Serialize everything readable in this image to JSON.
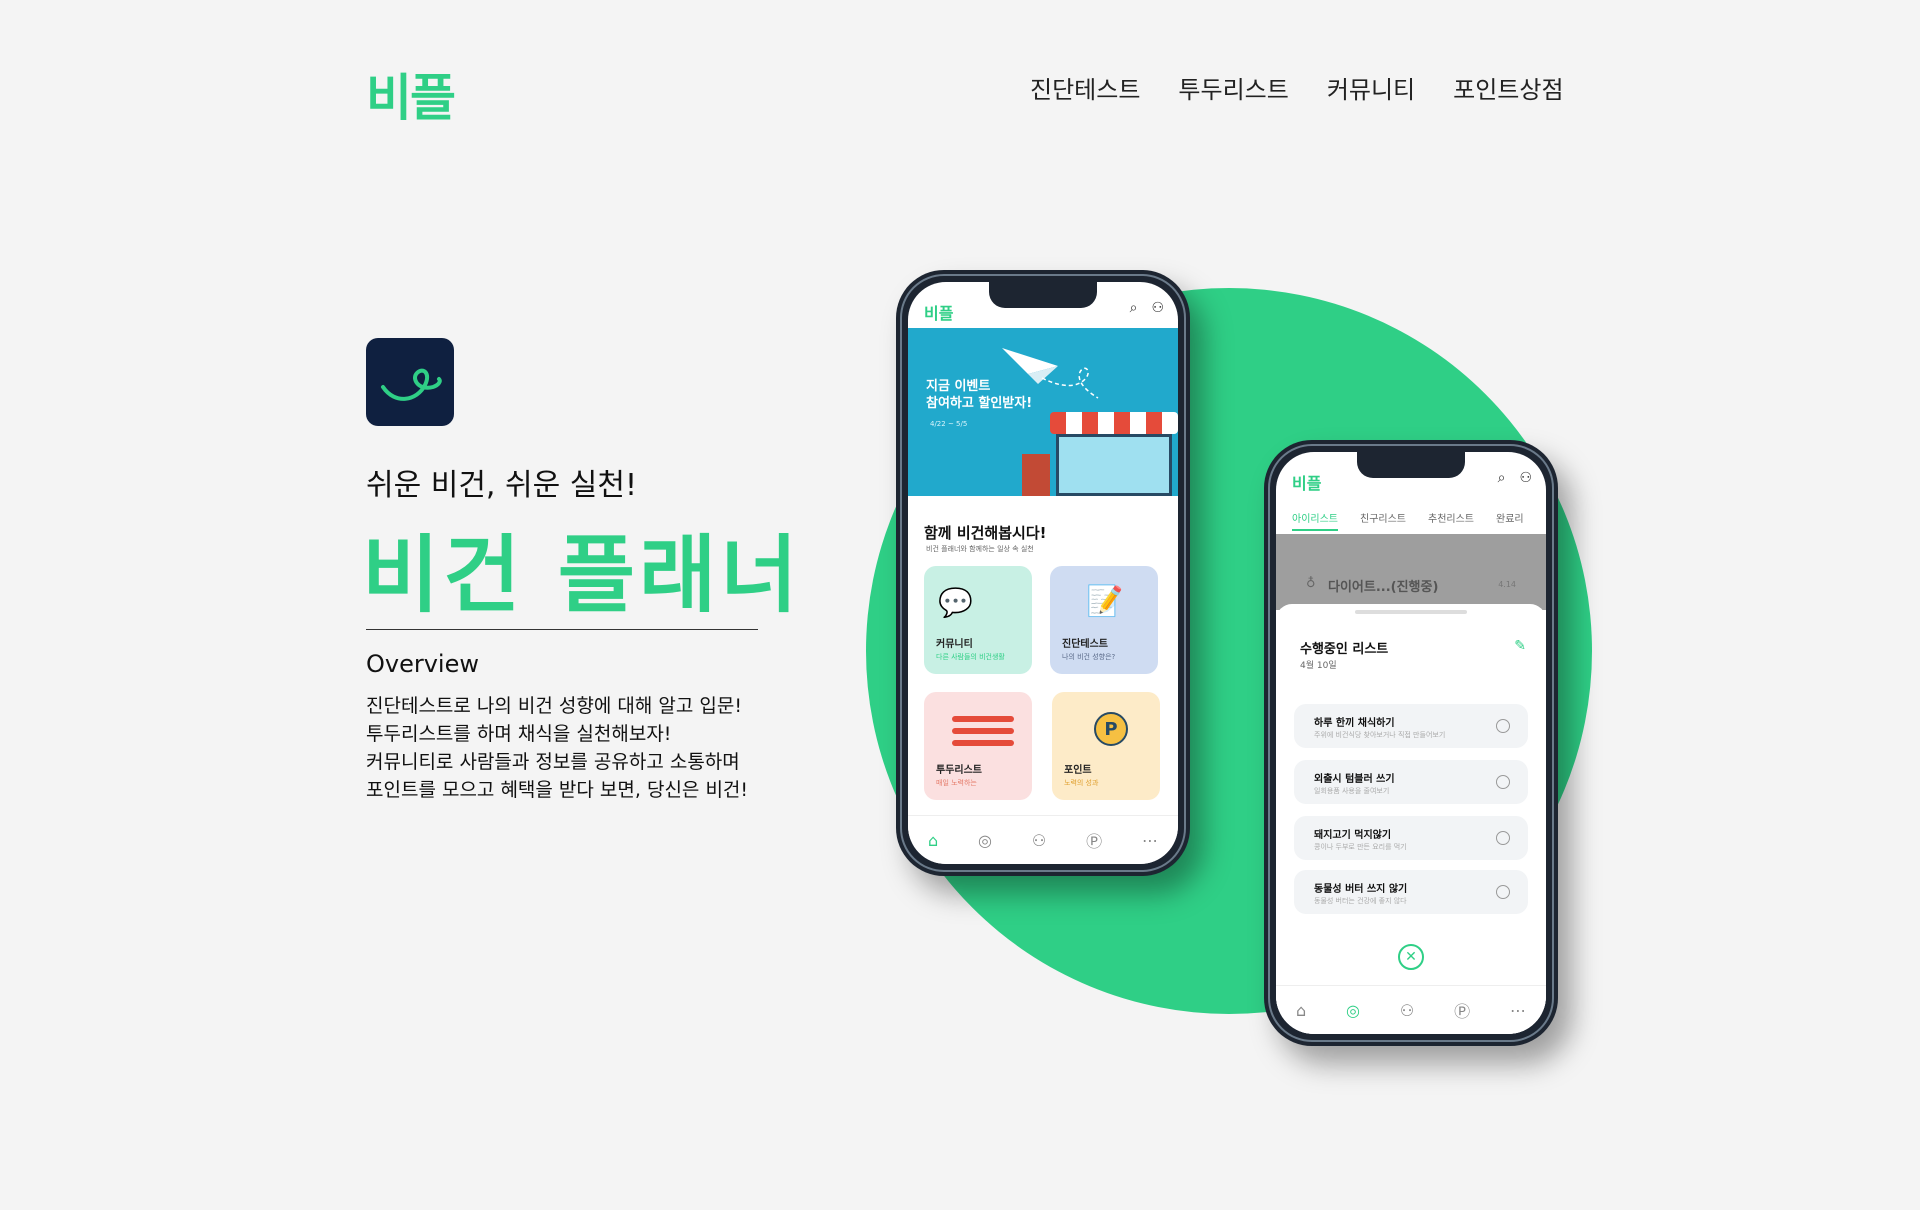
{
  "header": {
    "logo": "비플",
    "nav": [
      "진단테스트",
      "투두리스트",
      "커뮤니티",
      "포인트상점"
    ]
  },
  "hero": {
    "tagline": "쉬운 비건, 쉬운 실천!",
    "title": "비건 플래너",
    "overview_title": "Overview",
    "overview_lines": [
      "진단테스트로 나의 비건 성향에 대해 알고 입문!",
      "투두리스트를 하며 채식을 실천해보자!",
      "커뮤니티로 사람들과 정보를 공유하고 소통하며",
      "포인트를 모으고 혜택을 받다 보면, 당신은 비건!"
    ]
  },
  "colors": {
    "brand": "#2fcf86",
    "navy": "#0f2040",
    "banner": "#21a9cc"
  },
  "phone1": {
    "logo": "비플",
    "icons": [
      "search-icon",
      "user-icon"
    ],
    "banner": {
      "line1": "지금 이벤트",
      "line2": "참여하고 할인받자!",
      "dates": "4/22 ~ 5/5"
    },
    "section_title": "함께 비건해봅시다!",
    "section_sub": "비건 플래너와 함께하는 일상 속 실천",
    "cards": [
      {
        "label": "커뮤니티",
        "sub": "다른 사람들의 비건생활"
      },
      {
        "label": "진단테스트",
        "sub": "나의 비건 성향은?"
      },
      {
        "label": "투두리스트",
        "sub": "매일 노력하는"
      },
      {
        "label": "포인트",
        "sub": "노력의 성과"
      }
    ]
  },
  "phone2": {
    "logo": "비플",
    "tabs": [
      "아이리스트",
      "친구리스트",
      "추천리스트",
      "완료리"
    ],
    "overlay_item": "다이어트...(진행중)",
    "overlay_date": "4.14",
    "sheet_title": "수행중인 리스트",
    "sheet_date": "4월 10일",
    "items": [
      {
        "title": "하루 한끼 채식하기",
        "sub": "주위에 비건식당 찾아보거나 직접 만들어보기"
      },
      {
        "title": "외출시 텀블러 쓰기",
        "sub": "일회용품 사용을 줄여보기"
      },
      {
        "title": "돼지고기 먹지않기",
        "sub": "콩이나 두부로 만든 요리를 먹기"
      },
      {
        "title": "동물성 버터 쓰지 않기",
        "sub": "동물성 버터는 건강에 좋지 않다"
      }
    ]
  }
}
